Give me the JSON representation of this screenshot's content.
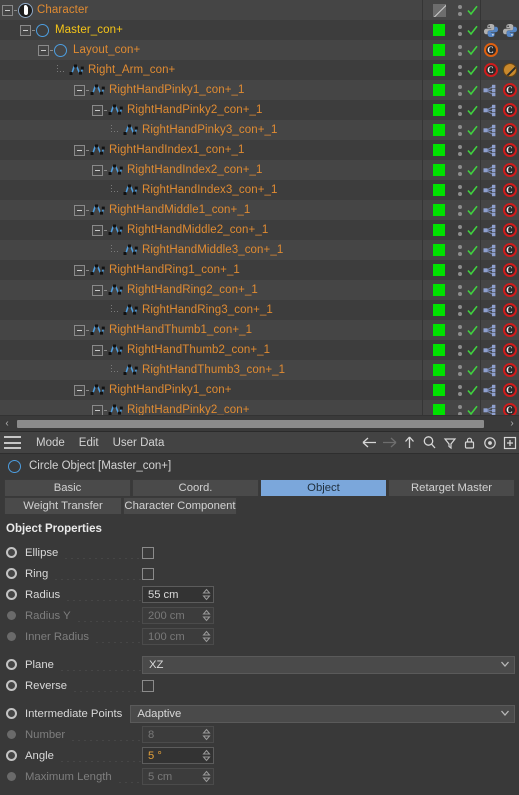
{
  "object_manager": {
    "rows": [
      {
        "label": "Character",
        "indent": 0,
        "icon": "character-icon",
        "expander": "open",
        "color": "orange",
        "visibility": "gray-disabled",
        "check": true,
        "tags": []
      },
      {
        "label": "Master_con+",
        "indent": 1,
        "icon": "circle-spline-icon",
        "expander": "open",
        "color": "yellow",
        "visibility": "green",
        "check": true,
        "tags": [
          "python-tag",
          "python-tag"
        ]
      },
      {
        "label": "Layout_con+",
        "indent": 2,
        "icon": "circle-spline-icon",
        "expander": "open",
        "color": "orange",
        "visibility": "green",
        "check": true,
        "tags": [
          "constraint-c-tag-orange"
        ]
      },
      {
        "label": "Right_Arm_con+",
        "indent": 3,
        "icon": "spline-icon",
        "expander": "leaf",
        "color": "orange",
        "visibility": "green",
        "check": true,
        "tags": [
          "constraint-c-tag-red",
          "expression-disabled-tag"
        ]
      },
      {
        "label": "RightHandPinky1_con+_1",
        "indent": 4,
        "icon": "spline-icon",
        "expander": "open",
        "color": "orange",
        "visibility": "green",
        "check": true,
        "tags": [
          "constraint-link-tag",
          "constraint-c-tag-red"
        ]
      },
      {
        "label": "RightHandPinky2_con+_1",
        "indent": 5,
        "icon": "spline-icon",
        "expander": "open",
        "color": "orange",
        "visibility": "green",
        "check": true,
        "tags": [
          "constraint-link-tag",
          "constraint-c-tag-red"
        ]
      },
      {
        "label": "RightHandPinky3_con+_1",
        "indent": 6,
        "icon": "spline-icon",
        "expander": "leaf",
        "color": "orange",
        "visibility": "green",
        "check": true,
        "tags": [
          "constraint-link-tag",
          "constraint-c-tag-red"
        ]
      },
      {
        "label": "RightHandIndex1_con+_1",
        "indent": 4,
        "icon": "spline-icon",
        "expander": "open",
        "color": "orange",
        "visibility": "green",
        "check": true,
        "tags": [
          "constraint-link-tag",
          "constraint-c-tag-red"
        ]
      },
      {
        "label": "RightHandIndex2_con+_1",
        "indent": 5,
        "icon": "spline-icon",
        "expander": "open",
        "color": "orange",
        "visibility": "green",
        "check": true,
        "tags": [
          "constraint-link-tag",
          "constraint-c-tag-red"
        ]
      },
      {
        "label": "RightHandIndex3_con+_1",
        "indent": 6,
        "icon": "spline-icon",
        "expander": "leaf",
        "color": "orange",
        "visibility": "green",
        "check": true,
        "tags": [
          "constraint-link-tag",
          "constraint-c-tag-red"
        ]
      },
      {
        "label": "RightHandMiddle1_con+_1",
        "indent": 4,
        "icon": "spline-icon",
        "expander": "open",
        "color": "orange",
        "visibility": "green",
        "check": true,
        "tags": [
          "constraint-link-tag",
          "constraint-c-tag-red"
        ]
      },
      {
        "label": "RightHandMiddle2_con+_1",
        "indent": 5,
        "icon": "spline-icon",
        "expander": "open",
        "color": "orange",
        "visibility": "green",
        "check": true,
        "tags": [
          "constraint-link-tag",
          "constraint-c-tag-red"
        ]
      },
      {
        "label": "RightHandMiddle3_con+_1",
        "indent": 6,
        "icon": "spline-icon",
        "expander": "leaf",
        "color": "orange",
        "visibility": "green",
        "check": true,
        "tags": [
          "constraint-link-tag",
          "constraint-c-tag-red"
        ]
      },
      {
        "label": "RightHandRing1_con+_1",
        "indent": 4,
        "icon": "spline-icon",
        "expander": "open",
        "color": "orange",
        "visibility": "green",
        "check": true,
        "tags": [
          "constraint-link-tag",
          "constraint-c-tag-red"
        ]
      },
      {
        "label": "RightHandRing2_con+_1",
        "indent": 5,
        "icon": "spline-icon",
        "expander": "open",
        "color": "orange",
        "visibility": "green",
        "check": true,
        "tags": [
          "constraint-link-tag",
          "constraint-c-tag-red"
        ]
      },
      {
        "label": "RightHandRing3_con+_1",
        "indent": 6,
        "icon": "spline-icon",
        "expander": "leaf",
        "color": "orange",
        "visibility": "green",
        "check": true,
        "tags": [
          "constraint-link-tag",
          "constraint-c-tag-red"
        ]
      },
      {
        "label": "RightHandThumb1_con+_1",
        "indent": 4,
        "icon": "spline-icon",
        "expander": "open",
        "color": "orange",
        "visibility": "green",
        "check": true,
        "tags": [
          "constraint-link-tag",
          "constraint-c-tag-red"
        ]
      },
      {
        "label": "RightHandThumb2_con+_1",
        "indent": 5,
        "icon": "spline-icon",
        "expander": "open",
        "color": "orange",
        "visibility": "green",
        "check": true,
        "tags": [
          "constraint-link-tag",
          "constraint-c-tag-red"
        ]
      },
      {
        "label": "RightHandThumb3_con+_1",
        "indent": 6,
        "icon": "spline-icon",
        "expander": "leaf",
        "color": "orange",
        "visibility": "green",
        "check": true,
        "tags": [
          "constraint-link-tag",
          "constraint-c-tag-red"
        ]
      },
      {
        "label": "RightHandPinky1_con+",
        "indent": 4,
        "icon": "spline-icon",
        "expander": "open",
        "color": "orange",
        "visibility": "green",
        "check": true,
        "tags": [
          "constraint-link-tag",
          "constraint-c-tag-red"
        ]
      },
      {
        "label": "RightHandPinky2_con+",
        "indent": 5,
        "icon": "spline-icon",
        "expander": "open",
        "color": "orange",
        "visibility": "green",
        "check": true,
        "tags": [
          "constraint-link-tag",
          "constraint-c-tag-red"
        ]
      }
    ],
    "scrollbar": {
      "left_arrow": "‹",
      "right_arrow": "›"
    }
  },
  "attribute_manager": {
    "menu": {
      "hamburger": "hamburger-icon",
      "items": [
        "Mode",
        "Edit",
        "User Data"
      ]
    },
    "toolbar_icons": [
      "arrow-left-icon",
      "arrow-right-icon",
      "arrow-up-icon",
      "search-icon",
      "filter-icon",
      "lock-icon",
      "target-icon",
      "add-panel-icon"
    ],
    "object_line": {
      "icon": "circle-spline-icon",
      "text": "Circle Object [Master_con+]"
    },
    "tabs_row1": [
      {
        "label": "Basic",
        "active": false
      },
      {
        "label": "Coord.",
        "active": false
      },
      {
        "label": "Object",
        "active": true
      },
      {
        "label": "Retarget Master",
        "active": false
      }
    ],
    "tabs_row2": [
      {
        "label": "Weight Transfer",
        "active": false
      },
      {
        "label": "Character Component",
        "active": false
      }
    ],
    "section_title": "Object Properties",
    "properties": [
      {
        "name": "Ellipse",
        "label": "Ellipse",
        "type": "checkbox",
        "value": false,
        "enabled": true,
        "anim": "on"
      },
      {
        "name": "Ring",
        "label": "Ring",
        "type": "checkbox",
        "value": false,
        "enabled": true,
        "anim": "on"
      },
      {
        "name": "Radius",
        "label": "Radius",
        "type": "number",
        "value": "55 cm",
        "enabled": true,
        "anim": "on"
      },
      {
        "name": "Radius Y",
        "label": "Radius Y",
        "type": "number",
        "value": "200 cm",
        "enabled": false,
        "anim": "off"
      },
      {
        "name": "Inner Radius",
        "label": "Inner Radius",
        "type": "number",
        "value": "100 cm",
        "enabled": false,
        "anim": "off"
      },
      {
        "name": "Plane",
        "label": "Plane",
        "type": "dropdown",
        "value": "XZ",
        "enabled": true,
        "anim": "on"
      },
      {
        "name": "Reverse",
        "label": "Reverse",
        "type": "checkbox",
        "value": false,
        "enabled": true,
        "anim": "on"
      },
      {
        "name": "Intermediate Points",
        "label": "Intermediate Points",
        "type": "dropdown-wide",
        "value": "Adaptive",
        "enabled": true,
        "anim": "on"
      },
      {
        "name": "Number",
        "label": "Number",
        "type": "number",
        "value": "8",
        "enabled": false,
        "anim": "off"
      },
      {
        "name": "Angle",
        "label": "Angle",
        "type": "number",
        "value": "5 °",
        "enabled": true,
        "anim": "on",
        "animated_value": true
      },
      {
        "name": "Maximum Length",
        "label": "Maximum Length",
        "type": "number",
        "value": "5 cm",
        "enabled": false,
        "anim": "off"
      }
    ]
  },
  "colors": {
    "object_orange": "#e08b32",
    "selected_yellow": "#f5c518",
    "visibility_green": "#00e200",
    "tab_active_blue": "#7ba7db",
    "spline_blue": "#4d9ee0",
    "tag_red": "#d01c1c",
    "tag_orange": "#e06010",
    "animated_value": "#e4a13a"
  }
}
